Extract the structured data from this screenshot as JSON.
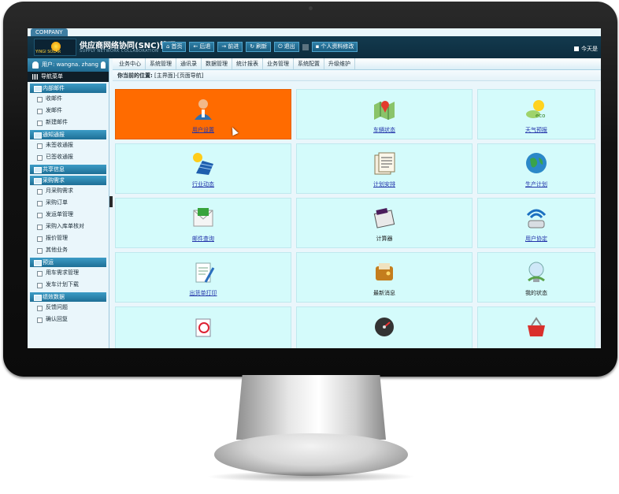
{
  "header": {
    "company_tab": "COMPANY",
    "logo_text": "YINGI SOLAR",
    "title": "供应商网络协同(SNC)管理",
    "subtitle": "SUPPLY NETWORK COLLABORATION",
    "nav_buttons": [
      {
        "label": "首页",
        "icon": "home-icon",
        "glyph": "⌂"
      },
      {
        "label": "后退",
        "icon": "back-arrow-icon",
        "glyph": "←"
      },
      {
        "label": "前进",
        "icon": "forward-arrow-icon",
        "glyph": "→"
      },
      {
        "label": "刷新",
        "icon": "refresh-icon",
        "glyph": "↻"
      },
      {
        "label": "退出",
        "icon": "power-icon",
        "glyph": "⏻"
      },
      {
        "label": "个人资料修改",
        "icon": "profile-icon",
        "glyph": "▪"
      }
    ],
    "today_label": "今天是"
  },
  "sidebar": {
    "user_label": "用户: wangna. zhang",
    "nav_title": "导航菜单",
    "sections": [
      {
        "title": "内部邮件",
        "items": [
          "收邮件",
          "发邮件",
          "新建邮件"
        ]
      },
      {
        "title": "通知通报",
        "items": [
          "未签收通报",
          "已签收通报"
        ]
      },
      {
        "title": "共享信息",
        "items": []
      },
      {
        "title": "采购需求",
        "items": [
          "月采购需求",
          "采购订单",
          "发运单管理",
          "采购入库单核对",
          "报价管理",
          "其他业务"
        ]
      },
      {
        "title": "预运",
        "items": [
          "用车需求管理",
          "发车计划下载"
        ]
      },
      {
        "title": "绩效数据",
        "items": [
          "反馈问题",
          "确认回复"
        ]
      }
    ]
  },
  "main": {
    "tabs": [
      "业务中心",
      "系统管理",
      "通讯录",
      "数据管理",
      "统计报表",
      "业务管理",
      "系统配置",
      "升级维护"
    ],
    "breadcrumb_label": "你当前的位置:",
    "breadcrumb_path": "[主界面]-[页面导航]",
    "tiles": [
      {
        "label": "用户设置",
        "icon": "user-settings-icon",
        "active": true,
        "link": true
      },
      {
        "label": "车辆状态",
        "icon": "map-pin-icon",
        "active": false,
        "link": true
      },
      {
        "label": "天气预报",
        "icon": "weather-icon",
        "active": false,
        "link": true
      },
      {
        "label": "行业动态",
        "icon": "solar-panel-icon",
        "active": false,
        "link": true
      },
      {
        "label": "计划安排",
        "icon": "newspaper-icon",
        "active": false,
        "link": true
      },
      {
        "label": "生产计划",
        "icon": "globe-icon",
        "active": false,
        "link": true
      },
      {
        "label": "邮件查询",
        "icon": "mail-icon",
        "active": false,
        "link": true
      },
      {
        "label": "计算器",
        "icon": "calculator-icon",
        "active": false,
        "link": false
      },
      {
        "label": "用户协定",
        "icon": "wifi-router-icon",
        "active": false,
        "link": true
      },
      {
        "label": "出货单打印",
        "icon": "clipboard-icon",
        "active": false,
        "link": true
      },
      {
        "label": "最新消息",
        "icon": "wallet-icon",
        "active": false,
        "link": false
      },
      {
        "label": "我的状态",
        "icon": "lightbulb-icon",
        "active": false,
        "link": false
      },
      {
        "label": "",
        "icon": "document-stamp-icon",
        "active": false,
        "link": false
      },
      {
        "label": "",
        "icon": "speedometer-icon",
        "active": false,
        "link": false
      },
      {
        "label": "",
        "icon": "shopping-basket-icon",
        "active": false,
        "link": false
      }
    ]
  },
  "colors": {
    "header_bg": "#0d2d3f",
    "tile_bg": "#d4fbfb",
    "tile_active": "#ff6b00",
    "section_head": "#1e6f96",
    "link": "#2233aa"
  }
}
